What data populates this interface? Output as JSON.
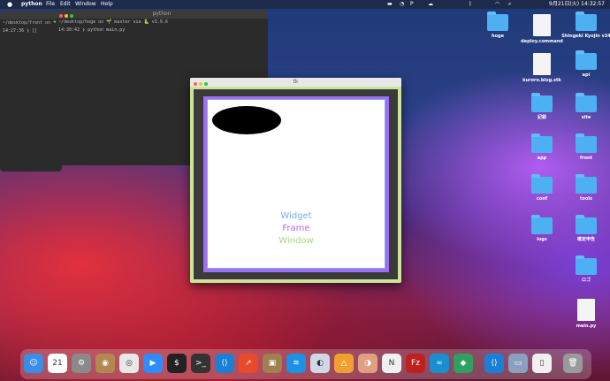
{
  "menubar": {
    "app": "python",
    "items": [
      "File",
      "Edit",
      "Window",
      "Help"
    ],
    "clock": "9月21日(火) 14:32:57"
  },
  "term_left": {
    "line1": "~/desktop/front on 🌱",
    "line2": "14:27:36 ❯ []"
  },
  "term_right": {
    "title": "python",
    "line1": "~/desktop/hoge on 🌱 master via 🐍 v3.9.6",
    "line2": "14:30:42 ❯ python main.py"
  },
  "tk": {
    "title": "tk",
    "labels": [
      "Widget",
      "Frame",
      "Window"
    ],
    "colors": {
      "widget": "#7aa9f0",
      "frame": "#a06ef0",
      "window": "#cde39a"
    }
  },
  "desktop_icons": [
    {
      "name": "hoge",
      "kind": "folder"
    },
    {
      "name": "deploy.command",
      "kind": "doc"
    },
    {
      "name": "Shingeki Kyojin v34",
      "kind": "folder"
    },
    {
      "name": "kuroro.blog.stk",
      "kind": "doc"
    },
    {
      "name": "api",
      "kind": "folder"
    },
    {
      "name": "記録",
      "kind": "folder"
    },
    {
      "name": "site",
      "kind": "folder"
    },
    {
      "name": "app",
      "kind": "folder"
    },
    {
      "name": "front",
      "kind": "folder"
    },
    {
      "name": "conf",
      "kind": "folder"
    },
    {
      "name": "tools",
      "kind": "folder"
    },
    {
      "name": "logs",
      "kind": "folder"
    },
    {
      "name": "確定申告",
      "kind": "folder"
    },
    {
      "name": "ロゴ",
      "kind": "folder"
    },
    {
      "name": "main.py",
      "kind": "doc"
    }
  ],
  "dock": [
    {
      "icon": "finder-icon",
      "glyph": "☺",
      "color": "#3a8ee6"
    },
    {
      "icon": "calendar-icon",
      "glyph": "21",
      "color": "#ffffff"
    },
    {
      "icon": "settings-icon",
      "glyph": "⚙",
      "color": "#8a8a8a"
    },
    {
      "icon": "contacts-icon",
      "glyph": "◉",
      "color": "#b08850"
    },
    {
      "icon": "chrome-icon",
      "glyph": "◎",
      "color": "#e8e8e8"
    },
    {
      "icon": "zoom-icon",
      "glyph": "▶",
      "color": "#2d8cff"
    },
    {
      "icon": "terminal-icon",
      "glyph": "$",
      "color": "#222222"
    },
    {
      "icon": "terminal2-icon",
      "glyph": ">_",
      "color": "#333333"
    },
    {
      "icon": "vscode-icon",
      "glyph": "⟨⟩",
      "color": "#1c7fd6"
    },
    {
      "icon": "chart-app-icon",
      "glyph": "↗",
      "color": "#e84a2b"
    },
    {
      "icon": "package-icon",
      "glyph": "▣",
      "color": "#a08050"
    },
    {
      "icon": "docker-icon",
      "glyph": "≋",
      "color": "#1d91e6"
    },
    {
      "icon": "proxyman-icon",
      "glyph": "◐",
      "color": "#d0d8e8"
    },
    {
      "icon": "sourcetree-icon",
      "glyph": "△",
      "color": "#f0a030"
    },
    {
      "icon": "preview-icon",
      "glyph": "◑",
      "color": "#e0a080"
    },
    {
      "icon": "notion-icon",
      "glyph": "N",
      "color": "#f0f0f0"
    },
    {
      "icon": "filezilla-icon",
      "glyph": "Fz",
      "color": "#c02020"
    },
    {
      "icon": "arduino-icon",
      "glyph": "∞",
      "color": "#1a8fd0"
    },
    {
      "icon": "diamond-app-icon",
      "glyph": "◆",
      "color": "#30a060"
    },
    {
      "icon": "vscode2-icon",
      "glyph": "⟨⟩",
      "color": "#1c7fd6"
    },
    {
      "icon": "screenshot-icon",
      "glyph": "▭",
      "color": "#8aa0c0"
    },
    {
      "icon": "document-icon",
      "glyph": "▯",
      "color": "#f0f0f0"
    },
    {
      "icon": "trash-icon",
      "glyph": "🗑",
      "color": "#9a9a9a"
    }
  ]
}
